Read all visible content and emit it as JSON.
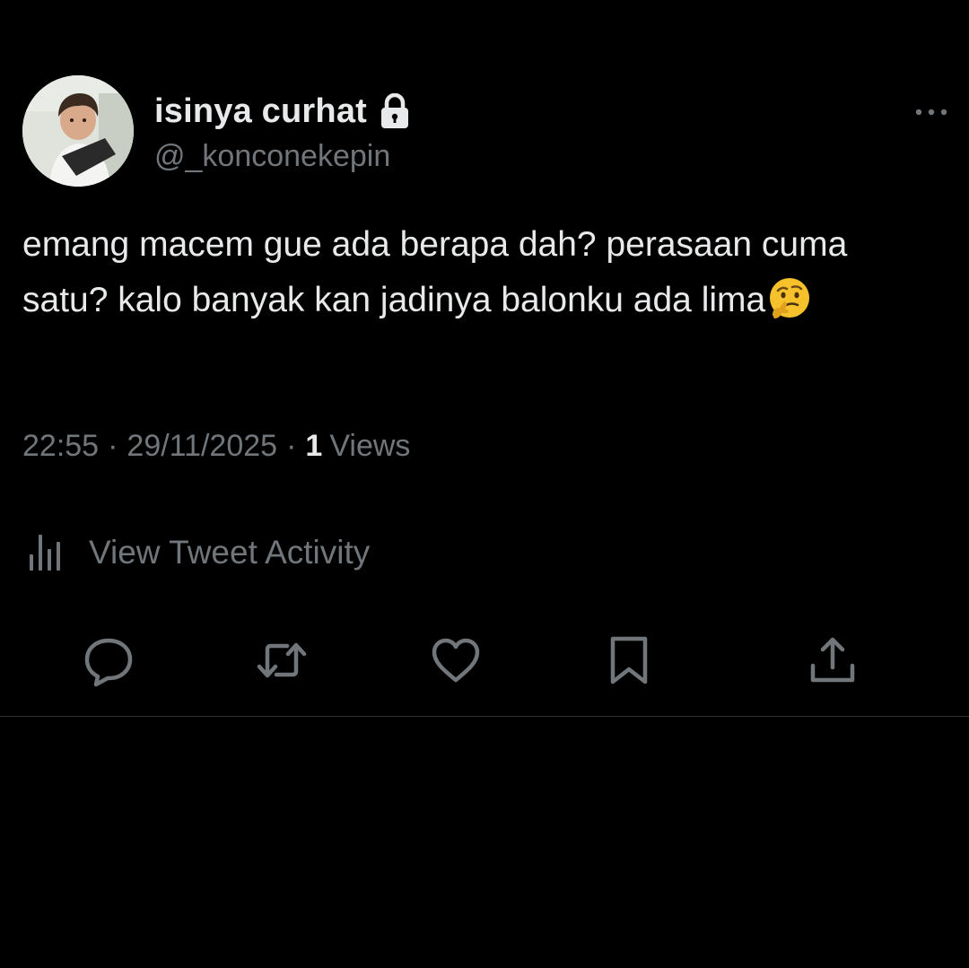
{
  "tweet": {
    "display_name": "isinya curhat",
    "handle": "@_konconekepin",
    "text": "emang macem gue ada berapa dah? perasaan cuma satu? kalo banyak kan jadinya balonku ada lima",
    "emoji": "thinking-face-emoji",
    "time": "22:55",
    "separator": "·",
    "date": "29/11/2025",
    "views_count": "1",
    "views_label": "Views",
    "locked": true
  },
  "activity": {
    "label": "View Tweet Activity",
    "icon": "bar-chart-icon"
  },
  "actions": [
    {
      "name": "reply",
      "icon": "speech-bubble-icon"
    },
    {
      "name": "retweet",
      "icon": "retweet-arrows-icon"
    },
    {
      "name": "like",
      "icon": "heart-icon"
    },
    {
      "name": "bookmark",
      "icon": "bookmark-icon"
    },
    {
      "name": "share",
      "icon": "upload-share-icon"
    }
  ],
  "colors": {
    "background": "#000000",
    "primary_text": "#e7e9ea",
    "secondary_text": "#71767b",
    "divider": "#2f3336",
    "emoji_yellow": "#f7c12b"
  }
}
